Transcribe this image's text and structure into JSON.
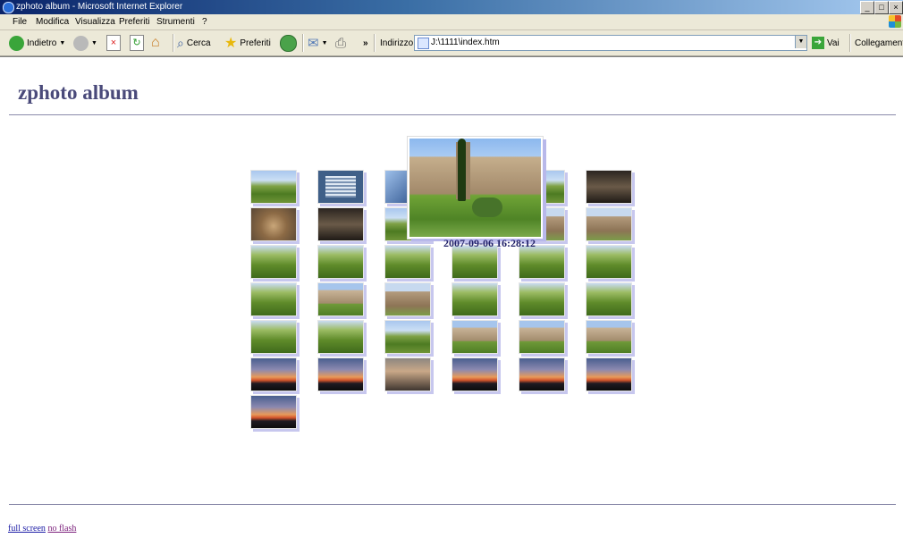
{
  "window": {
    "title": "zphoto album - Microsoft Internet Explorer"
  },
  "menu": [
    "File",
    "Modifica",
    "Visualizza",
    "Preferiti",
    "Strumenti",
    "?"
  ],
  "toolbar": {
    "back": "Indietro",
    "search": "Cerca",
    "favorites": "Preferiti",
    "address_label": "Indirizzo",
    "address_value": "J:\\1111\\index.htm",
    "go": "Vai",
    "links": "Collegamenti"
  },
  "page": {
    "title": "zphoto album",
    "enlarged_caption": "2007-09-06 16:28:12",
    "footer": {
      "fullscreen": "full screen",
      "noflash": "no flash"
    }
  },
  "photos": {
    "rows": [
      [
        "field",
        "doc",
        "blue",
        "church",
        "field",
        "dark"
      ],
      [
        "fresco",
        "dark",
        "field",
        "olive",
        "portrait",
        "portrait"
      ],
      [
        "olive",
        "olive",
        "olive",
        "olive",
        "olive",
        "olive"
      ],
      [
        "olive",
        "church",
        "portrait",
        "olive",
        "olive",
        "olive"
      ],
      [
        "olive",
        "olive",
        "field",
        "church",
        "church",
        "church"
      ],
      [
        "sunset",
        "sunset",
        "person",
        "sunset",
        "sunset",
        "sunset"
      ],
      [
        "sunset"
      ]
    ]
  },
  "colors": {
    "title": "#4a4a7a",
    "shadow": "#c7c7ee",
    "caption": "#23236a"
  }
}
